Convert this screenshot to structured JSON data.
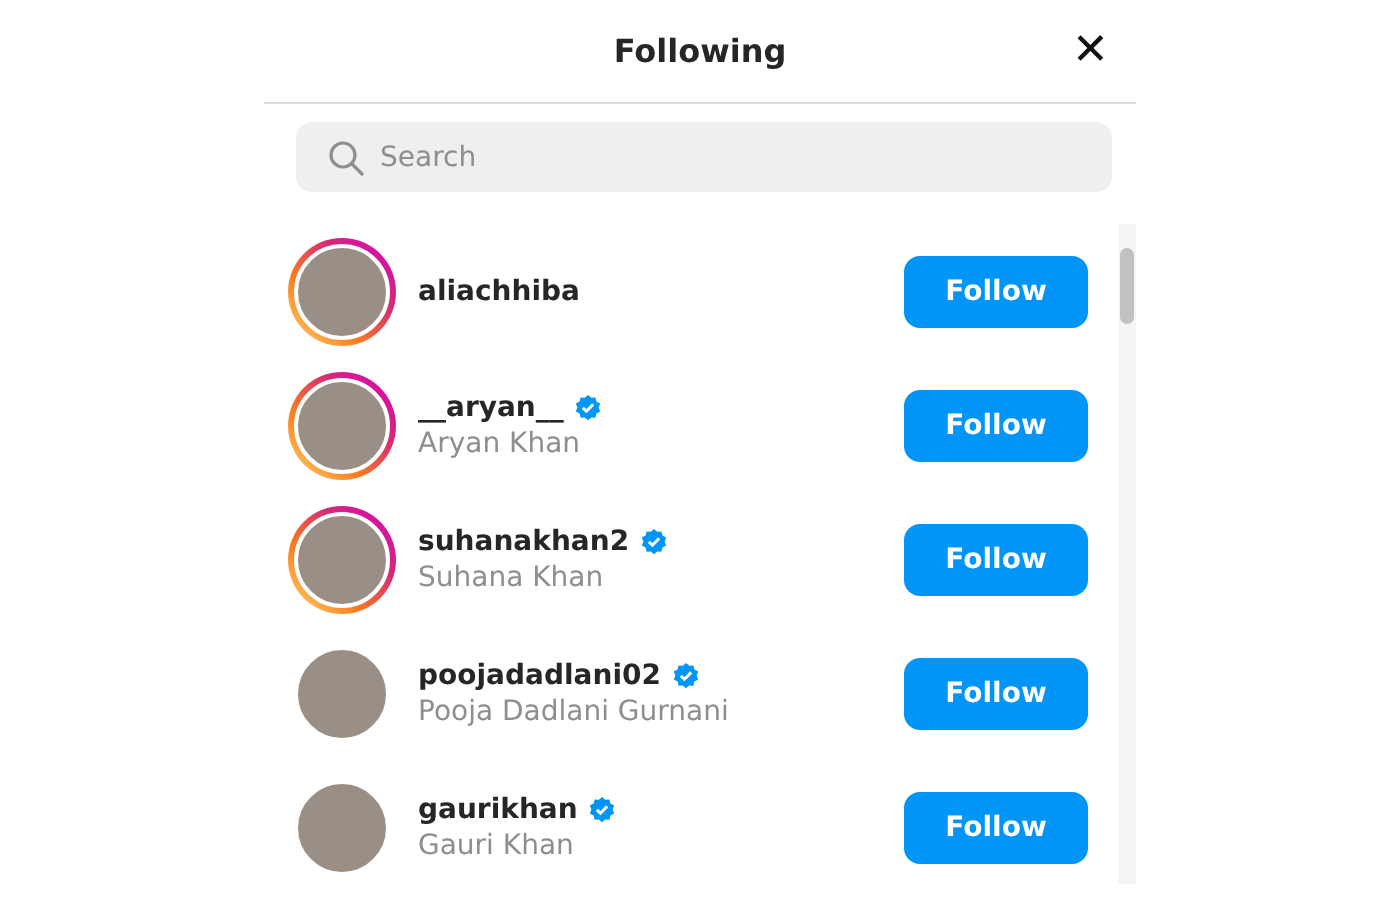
{
  "dialog": {
    "title": "Following",
    "close": "✕"
  },
  "search": {
    "placeholder": "Search"
  },
  "users": [
    {
      "username": "aliachhiba",
      "has_story": true,
      "verified": false,
      "button": "Follow"
    },
    {
      "username": "__aryan__",
      "full_name": "Aryan Khan",
      "has_story": true,
      "verified": true,
      "button": "Follow"
    },
    {
      "username": "suhanakhan2",
      "full_name": "Suhana Khan",
      "has_story": true,
      "verified": true,
      "button": "Follow"
    },
    {
      "username": "poojadadlani02",
      "full_name": "Pooja Dadlani Gurnani",
      "has_story": false,
      "verified": true,
      "button": "Follow"
    },
    {
      "username": "gaurikhan",
      "full_name": "Gauri Khan",
      "has_story": false,
      "verified": true,
      "button": "Follow"
    }
  ]
}
